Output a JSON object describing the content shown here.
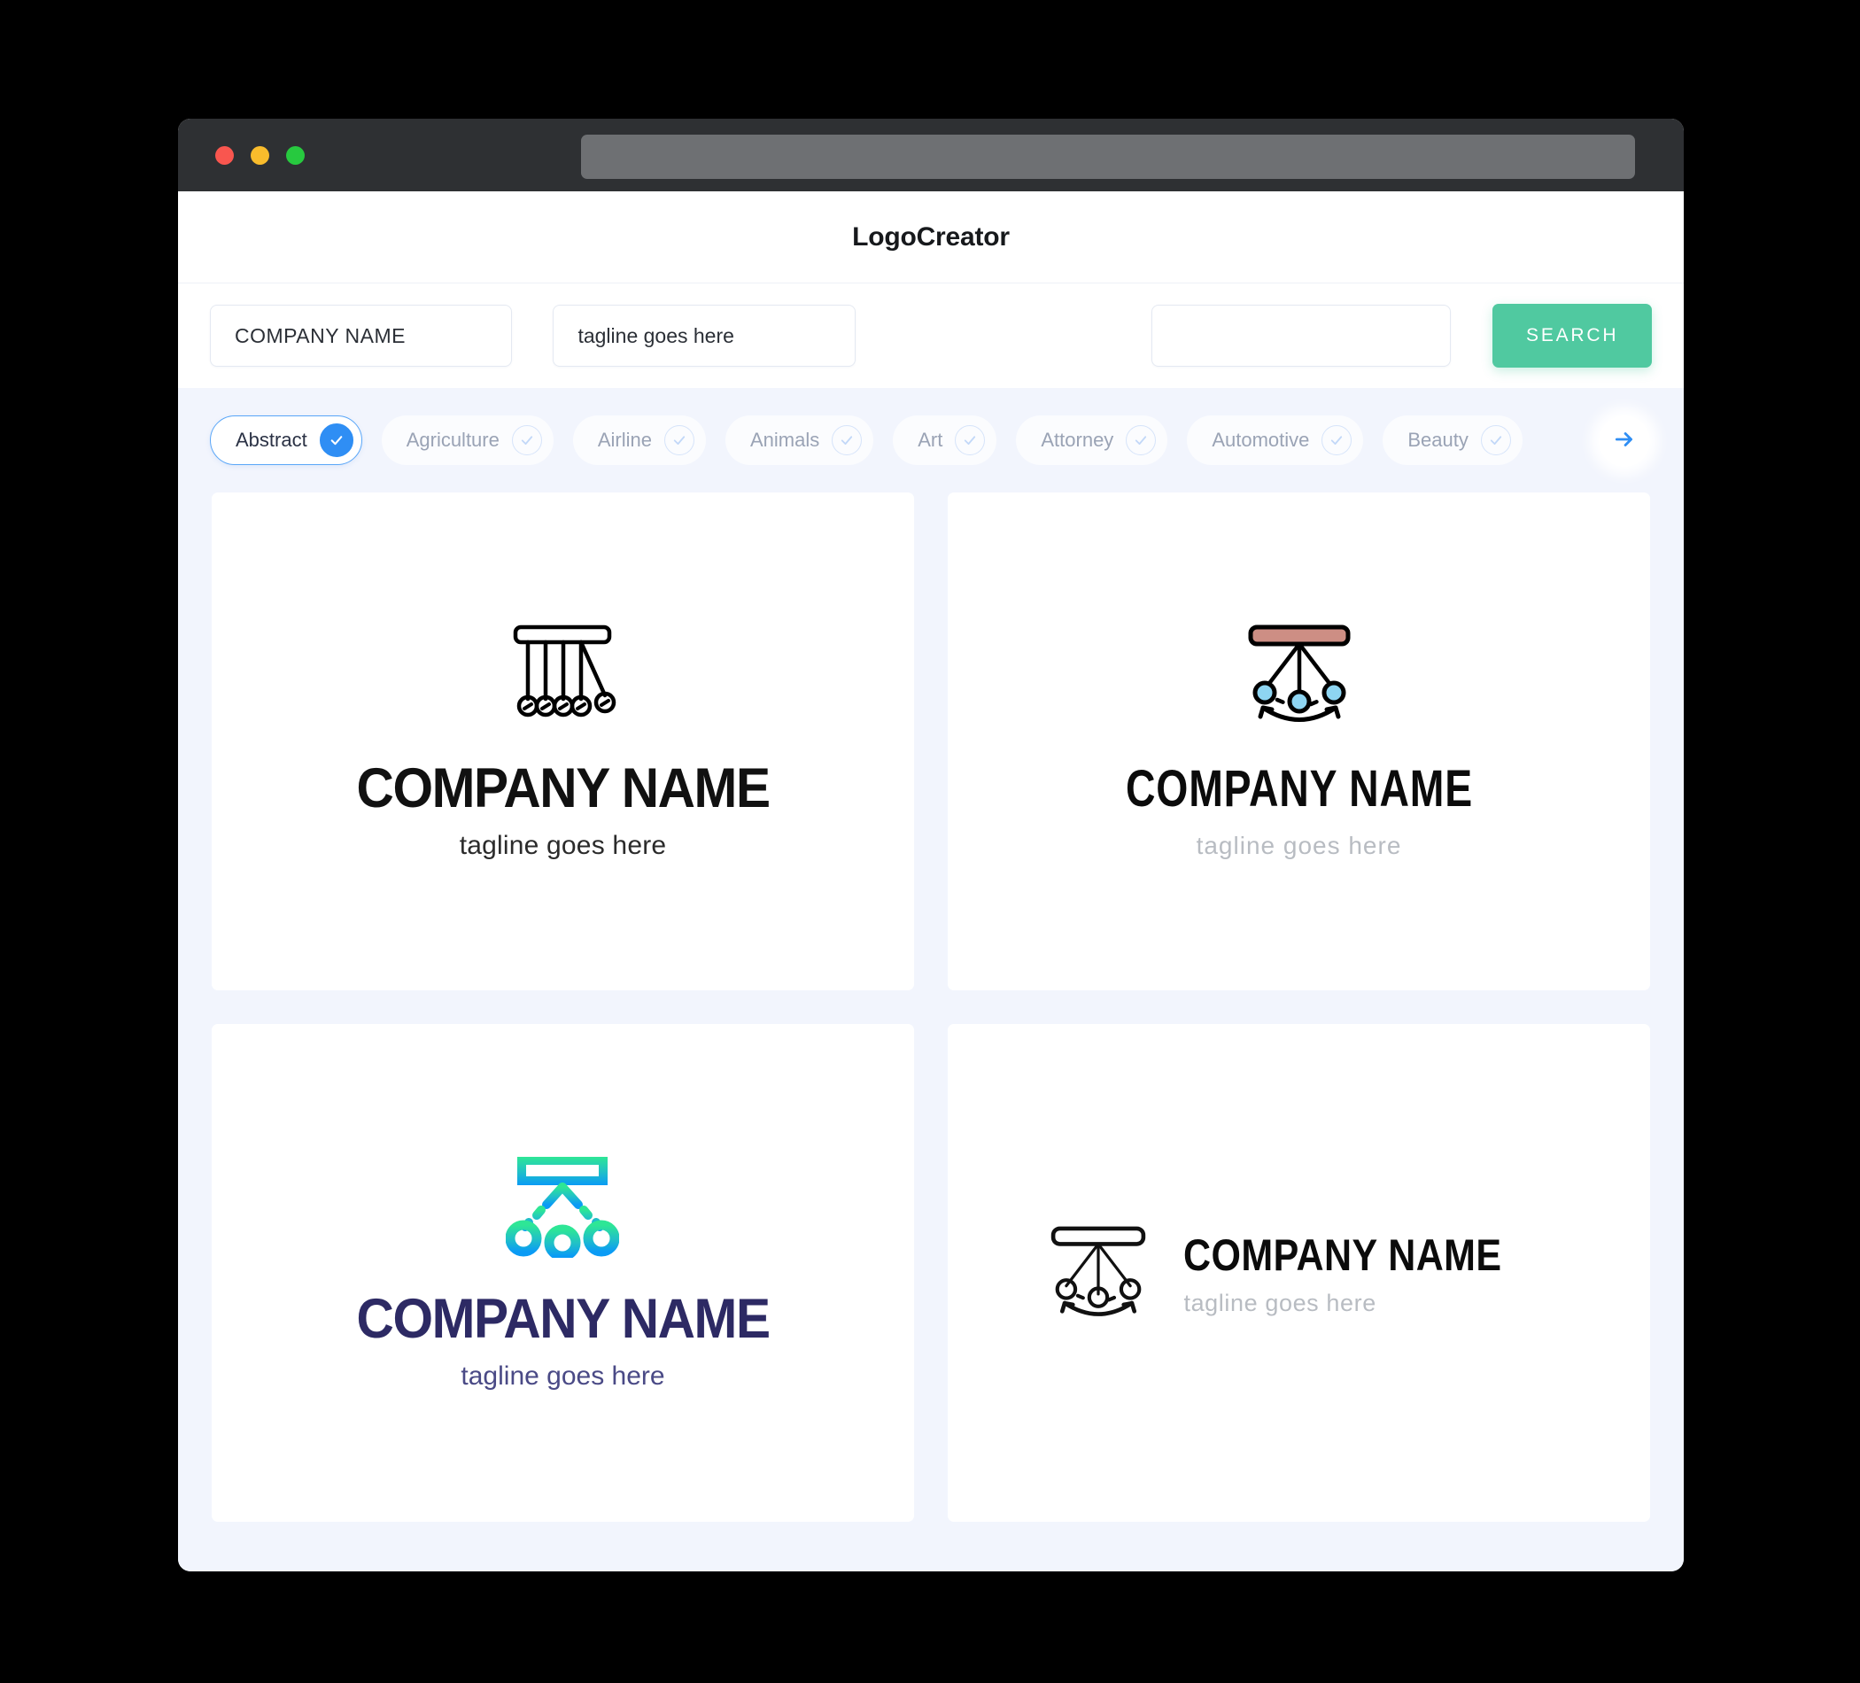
{
  "browser": {
    "traffic_lights": [
      "close",
      "minimize",
      "maximize"
    ],
    "url_value": ""
  },
  "header": {
    "app_title": "LogoCreator"
  },
  "search": {
    "company_value": "COMPANY NAME",
    "company_placeholder": "COMPANY NAME",
    "tagline_value": "tagline goes here",
    "tagline_placeholder": "tagline goes here",
    "keyword_value": "",
    "keyword_placeholder": "",
    "search_button_label": "SEARCH",
    "search_button_color": "#50c9a0"
  },
  "categories": {
    "items": [
      {
        "label": "Abstract",
        "selected": true
      },
      {
        "label": "Agriculture",
        "selected": false
      },
      {
        "label": "Airline",
        "selected": false
      },
      {
        "label": "Animals",
        "selected": false
      },
      {
        "label": "Art",
        "selected": false
      },
      {
        "label": "Attorney",
        "selected": false
      },
      {
        "label": "Automotive",
        "selected": false
      },
      {
        "label": "Beauty",
        "selected": false
      }
    ],
    "next_icon": "arrow-right-icon",
    "active_color": "#2f8ef4"
  },
  "results": {
    "cards": [
      {
        "icon": "newtons-cradle-icon",
        "layout": "vertical",
        "name": "COMPANY NAME",
        "tagline": "tagline goes here",
        "name_color": "#111111",
        "tagline_color": "#2b2b2b"
      },
      {
        "icon": "pendulum-swing-icon",
        "layout": "vertical",
        "name": "COMPANY NAME",
        "tagline": "tagline goes here",
        "name_color": "#0b0b0b",
        "tagline_color": "#b8bcc2",
        "bar_color": "#cd8e84",
        "ball_color": "#8ed5f2"
      },
      {
        "icon": "pendulum-swing-icon",
        "layout": "vertical",
        "name": "COMPANY NAME",
        "tagline": "tagline goes here",
        "name_color": "#2d2a64",
        "tagline_color": "#4a4a86",
        "gradient_from": "#2ee696",
        "gradient_to": "#0a9bf5"
      },
      {
        "icon": "pendulum-swing-icon",
        "layout": "horizontal",
        "name": "COMPANY NAME",
        "tagline": "tagline goes here",
        "name_color": "#0b0b0b",
        "tagline_color": "#b8bcc2"
      }
    ]
  }
}
